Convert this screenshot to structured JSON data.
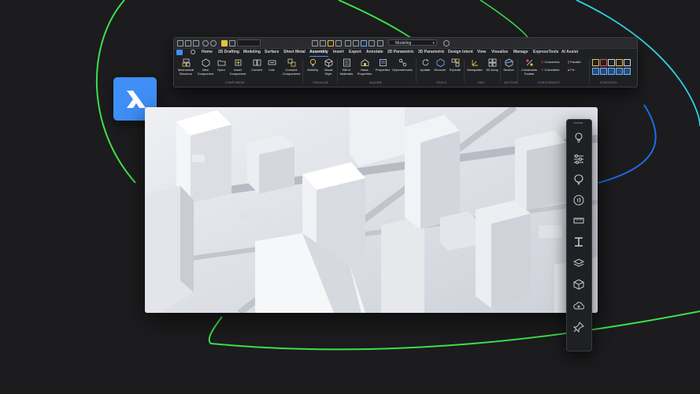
{
  "app": {
    "brand_color": "#3f8ff7",
    "background_color": "#1c1c1e",
    "accent_lines": [
      "#3de04a",
      "#1d8ef0",
      "#2fd2e8"
    ]
  },
  "ribbon": {
    "workspace": "Modeling",
    "tabs": [
      "Home",
      "2D Drafting",
      "Modeling",
      "Surface",
      "Sheet Metal",
      "Assembly",
      "Insert",
      "Export",
      "Annotate",
      "2D Parametric",
      "3D Parametric",
      "Design Intent",
      "View",
      "Visualize",
      "Manage",
      "ExpressTools",
      "AI Assist"
    ],
    "active_tab": "Assembly",
    "tools": {
      "mechanical_structure": "Mechanical Structure",
      "new_component": "New Component",
      "open": "Open",
      "insert_component": "Insert Component",
      "convert": "Convert",
      "link": "Link",
      "connect_components": "Connect Components",
      "visibility": "Visibility",
      "visual_style": "Visual Style",
      "bill_of_materials": "Bill of Materials",
      "mass_properties": "Mass Properties",
      "properties": "Properties",
      "dependencies": "Dependencies",
      "update": "Update",
      "recover": "Recover",
      "explode": "Explode",
      "manipulate": "Manipulate",
      "array_3d": "3D Array",
      "section": "Section",
      "constraints_toolbar": "Constraints Toolbar",
      "concentric": "Concentric",
      "coincident": "Coincident",
      "parallel": "Parallel",
      "fix": "Fix"
    },
    "groups": {
      "component": "COMPONENT",
      "visualize": "VISUALIZE",
      "inquire": "INQUIRE",
      "tools": "TOOLS",
      "edit": "EDIT",
      "section": "SECTION",
      "constraints": "CONSTRAINTS",
      "controls": "CONTROLS"
    }
  },
  "side_panel": {
    "icons": [
      "lightbulb-icon",
      "sliders-icon",
      "balloon-icon",
      "audio-waves-icon",
      "ruler-icon",
      "i-beam-icon",
      "layers-icon",
      "cube-icon",
      "cloud-upload-icon",
      "pin-icon"
    ]
  }
}
